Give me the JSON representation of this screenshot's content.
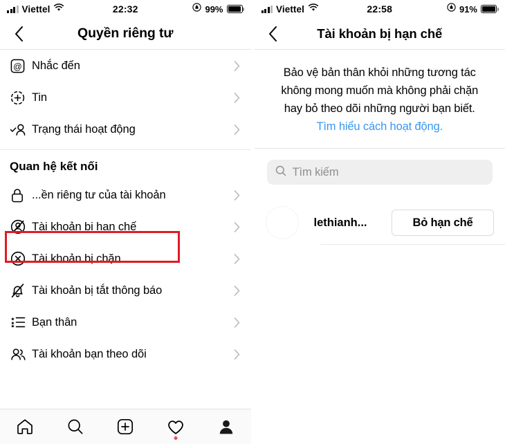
{
  "left": {
    "status": {
      "carrier": "Viettel",
      "time": "22:32",
      "battery": "99%",
      "wifi_icon": "wifi-icon",
      "signal_icon": "cellular-signal-icon",
      "lock_rotation_icon": "rotation-lock-icon",
      "battery_icon": "battery-icon"
    },
    "nav": {
      "back_icon": "back-chevron-icon",
      "title": "Quyền riêng tư"
    },
    "items_top": [
      {
        "icon": "mention-at-icon",
        "label": "Nhắc đến",
        "chevron": "chevron-right-icon"
      },
      {
        "icon": "story-plus-icon",
        "label": "Tin",
        "chevron": "chevron-right-icon"
      },
      {
        "icon": "activity-status-icon",
        "label": "Trạng thái hoạt động",
        "chevron": "chevron-right-icon"
      }
    ],
    "section_title": "Quan hệ kết nối",
    "items_bottom": [
      {
        "icon": "lock-icon",
        "label": "...ền riêng tư của tài khoản",
        "chevron": "chevron-right-icon"
      },
      {
        "icon": "restricted-account-icon",
        "label": "Tài khoản bị hạn chế",
        "chevron": "chevron-right-icon"
      },
      {
        "icon": "blocked-account-icon",
        "label": "Tài khoản bị chặn",
        "chevron": "chevron-right-icon"
      },
      {
        "icon": "muted-bell-icon",
        "label": "Tài khoản bị tắt thông báo",
        "chevron": "chevron-right-icon"
      },
      {
        "icon": "close-friends-icon",
        "label": "Bạn thân",
        "chevron": "chevron-right-icon"
      },
      {
        "icon": "following-accounts-icon",
        "label": "Tài khoản bạn theo dõi",
        "chevron": "chevron-right-icon"
      }
    ],
    "tabbar": [
      {
        "icon": "home-icon",
        "name": "tab-home"
      },
      {
        "icon": "search-icon",
        "name": "tab-search"
      },
      {
        "icon": "add-post-icon",
        "name": "tab-add"
      },
      {
        "icon": "heart-activity-icon",
        "name": "tab-activity",
        "badge": true
      },
      {
        "icon": "profile-avatar-icon",
        "name": "tab-profile",
        "active": true
      }
    ],
    "highlight_color": "#e01b24"
  },
  "right": {
    "status": {
      "carrier": "Viettel",
      "time": "22:58",
      "battery": "91%"
    },
    "nav": {
      "back_icon": "back-chevron-icon",
      "title": "Tài khoản bị hạn chế"
    },
    "description": {
      "text": "Bảo vệ bản thân khỏi những tương tác không mong muốn mà không phải chặn hay bỏ theo dõi những người bạn biết. ",
      "link": "Tìm hiểu cách hoạt động.",
      "link_color": "#3897f0"
    },
    "search": {
      "icon": "search-icon",
      "placeholder": "Tìm kiếm",
      "value": ""
    },
    "users": [
      {
        "avatar": "user-avatar",
        "username": "lethianh...",
        "action_label": "Bỏ hạn chế"
      }
    ],
    "highlight_color": "#e01b24"
  }
}
